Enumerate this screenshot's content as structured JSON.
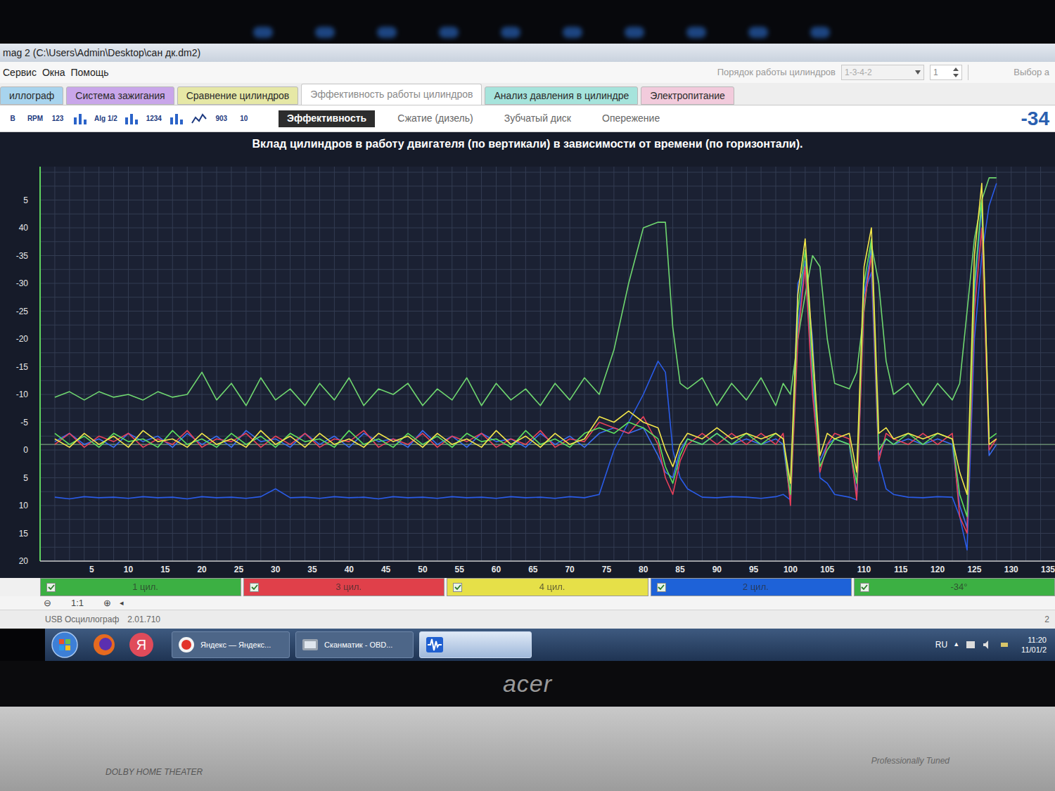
{
  "window": {
    "title": "mag 2 (C:\\Users\\Admin\\Desktop\\сан дк.dm2)"
  },
  "menu": [
    "Сервис",
    "Окна",
    "Помощь"
  ],
  "cylinder_order": {
    "label": "Порядок работы цилиндров",
    "value": "1-3-4-2",
    "spinner": "1",
    "extra": "Выбор а"
  },
  "tabs": [
    {
      "label": "иллограф",
      "selected": false,
      "color": "#a8d4ee"
    },
    {
      "label": "Система зажигания",
      "selected": false,
      "color": "#c9a6ea"
    },
    {
      "label": "Сравнение цилиндров",
      "selected": false,
      "color": "#e6e8a6"
    },
    {
      "label": "Эффективность работы цилиндров",
      "selected": true,
      "color": "#ffffff"
    },
    {
      "label": "Анализ давления в цилиндре",
      "selected": false,
      "color": "#a6e4dc"
    },
    {
      "label": "Электропитание",
      "selected": false,
      "color": "#f2cbdc"
    }
  ],
  "toolbar": {
    "icons": [
      {
        "text": "B"
      },
      {
        "text": "RPM"
      },
      {
        "text": "123"
      },
      {
        "text": ""
      },
      {
        "text": "Alg 1/2"
      },
      {
        "text": ""
      },
      {
        "text": "1234"
      },
      {
        "text": ""
      },
      {
        "text": ""
      },
      {
        "text": "903"
      },
      {
        "text": "10"
      }
    ],
    "modes": [
      {
        "label": "Эффективность",
        "selected": true
      },
      {
        "label": "Сжатие (дизель)",
        "selected": false
      },
      {
        "label": "Зубчатый диск",
        "selected": false
      },
      {
        "label": "Опережение",
        "selected": false
      }
    ],
    "reading": "-34"
  },
  "chart": {
    "title": "Вклад цилиндров в работу двигателя (по вертикали) в зависимости от времени (по горизонтали).",
    "x_ticks": [
      "5",
      "10",
      "15",
      "20",
      "25",
      "30",
      "35",
      "40",
      "45",
      "50",
      "55",
      "60",
      "65",
      "70",
      "75",
      "80",
      "85",
      "90",
      "95",
      "100",
      "105",
      "110",
      "115",
      "120",
      "125",
      "130",
      "135"
    ],
    "y_ticks": [
      {
        "label": "5",
        "value": -45
      },
      {
        "label": "40",
        "value": -40
      },
      {
        "label": "-35",
        "value": -35
      },
      {
        "label": "-30",
        "value": -30
      },
      {
        "label": "-25",
        "value": -25
      },
      {
        "label": "-20",
        "value": -20
      },
      {
        "label": "-15",
        "value": -15
      },
      {
        "label": "-10",
        "value": -10
      },
      {
        "label": "-5",
        "value": -5
      },
      {
        "label": "0",
        "value": 0
      },
      {
        "label": "5",
        "value": 5
      },
      {
        "label": "10",
        "value": 10
      },
      {
        "label": "15",
        "value": 15
      },
      {
        "label": "20",
        "value": 20
      }
    ],
    "x": [
      0,
      2,
      4,
      6,
      8,
      10,
      12,
      14,
      16,
      18,
      20,
      22,
      24,
      26,
      28,
      30,
      32,
      34,
      36,
      38,
      40,
      42,
      44,
      46,
      48,
      50,
      52,
      54,
      56,
      58,
      60,
      62,
      64,
      66,
      68,
      70,
      72,
      74,
      76,
      78,
      80,
      82,
      83,
      84,
      85,
      86,
      88,
      90,
      92,
      94,
      96,
      98,
      99,
      100,
      101,
      102,
      103,
      104,
      105,
      106,
      108,
      109,
      110,
      111,
      112,
      113,
      114,
      116,
      118,
      120,
      122,
      123,
      124,
      125,
      126,
      127,
      128
    ],
    "series": [
      {
        "color": "#6fd66f",
        "values": [
          -9.5,
          -10.5,
          -9,
          -10.5,
          -9.5,
          -10,
          -9,
          -10.5,
          -9.5,
          -10,
          -14,
          -9,
          -12,
          -8,
          -13,
          -9,
          -11,
          -8,
          -12,
          -9,
          -13,
          -8,
          -11,
          -10,
          -12,
          -8,
          -11,
          -9,
          -13,
          -8,
          -12,
          -9,
          -11,
          -8,
          -12,
          -9,
          -13,
          -10,
          -18,
          -30,
          -40,
          -41,
          -41,
          -22,
          -12,
          -11,
          -13,
          -8,
          -12,
          -9,
          -13,
          -8,
          -12,
          -10,
          -20,
          -28,
          -35,
          -33,
          -20,
          -12,
          -11,
          -14,
          -25,
          -37,
          -30,
          -16,
          -10,
          -12,
          -8,
          -12,
          -9,
          -12,
          -25,
          -38,
          -45,
          -49,
          -49
        ]
      },
      {
        "color": "#2a5ce8",
        "values": [
          8.5,
          8.8,
          8.4,
          8.6,
          8.5,
          8.7,
          8.4,
          8.6,
          8.5,
          8.8,
          8.4,
          8.6,
          8.5,
          8.7,
          8.4,
          7,
          8.6,
          8.5,
          8.7,
          8.4,
          8.6,
          8.5,
          8.8,
          8.4,
          8.6,
          8.5,
          8.7,
          8.4,
          8.6,
          8.5,
          8.7,
          8.4,
          8.6,
          8.5,
          8.7,
          8.4,
          8.6,
          8,
          0,
          -5,
          -10,
          -16,
          -14,
          0,
          5,
          7,
          8.5,
          8.6,
          8.4,
          8.5,
          8.7,
          8.4,
          8,
          9,
          -30,
          -33,
          -20,
          5,
          6,
          8,
          8.5,
          9,
          -28,
          -32,
          2,
          7,
          8,
          8.5,
          8.6,
          8.4,
          8.5,
          12,
          18,
          -20,
          -35,
          -44,
          -48
        ]
      },
      {
        "color": "#3a6cf0",
        "values": [
          -1.5,
          -3,
          -1,
          -2,
          -0.5,
          -3,
          -1.5,
          -2.5,
          -0.5,
          -3,
          -1,
          -2.5,
          -0.5,
          -3.5,
          -1.5,
          -2,
          -0.5,
          -3,
          -1,
          -2.5,
          -0.5,
          -3,
          -1.5,
          -2,
          -0.5,
          -3.5,
          -1,
          -2.5,
          -0.5,
          -3,
          -1.5,
          -2,
          -0.5,
          -3,
          -1,
          -2.5,
          -0.5,
          -3,
          -4,
          -3,
          -4,
          1,
          4,
          5,
          0,
          -2,
          -1,
          -3,
          -1,
          -2,
          -1,
          -2,
          -1,
          9,
          -22,
          -34,
          -12,
          2,
          -1,
          -2,
          -1,
          8,
          -28,
          -36,
          1,
          -2,
          -1,
          -2,
          -1,
          -2,
          -1,
          10,
          14,
          -28,
          -44,
          1,
          -1
        ]
      },
      {
        "color": "#e8405a",
        "values": [
          -1,
          -3,
          -0.5,
          -2.5,
          -1.5,
          -3,
          -0.5,
          -2,
          -1,
          -3.5,
          -0.5,
          -2,
          -1.5,
          -3,
          -0.5,
          -2.5,
          -1,
          -3,
          -0.5,
          -2,
          -1.5,
          -3.5,
          -0.5,
          -2,
          -1,
          -3,
          -0.5,
          -2.5,
          -1.5,
          -3,
          -0.5,
          -2,
          -1,
          -3.5,
          -0.5,
          -2,
          -1.5,
          -5,
          -4,
          -3,
          -6,
          -1,
          5,
          8,
          2,
          -1,
          -3,
          -1,
          -3,
          -1,
          -3,
          -1,
          -3,
          10,
          -20,
          -33,
          -10,
          4,
          -1,
          -3,
          -2,
          9,
          -26,
          -35,
          2,
          -3,
          -2,
          -1,
          -3,
          -1,
          -3,
          12,
          15,
          -25,
          -40,
          0,
          -2
        ]
      },
      {
        "color": "#5ee05e",
        "values": [
          -3,
          -1,
          -2.5,
          -0.5,
          -3,
          -1.5,
          -2,
          -0.5,
          -3.5,
          -1,
          -2,
          -0.5,
          -3,
          -1,
          -2.5,
          -0.5,
          -3,
          -1.5,
          -2,
          -0.5,
          -3.5,
          -1,
          -2,
          -0.5,
          -3,
          -1,
          -2.5,
          -0.5,
          -3,
          -1.5,
          -2,
          -0.5,
          -3.5,
          -1,
          -2,
          -0.5,
          -3,
          -4,
          -3,
          -5,
          -4,
          -2,
          3,
          6,
          1,
          -2,
          -1,
          -3,
          -1,
          -3,
          -1,
          -3,
          -2,
          8,
          -25,
          -36,
          -15,
          3,
          0,
          -2,
          -1,
          6,
          -30,
          -38,
          0,
          -2,
          -1,
          -3,
          -1,
          -3,
          -2,
          8,
          12,
          -30,
          -45,
          -2,
          -3
        ]
      },
      {
        "color": "#f2e64a",
        "values": [
          -2,
          -0.5,
          -3,
          -1,
          -2.5,
          -0.5,
          -3.5,
          -1.5,
          -2,
          -0.5,
          -3,
          -1,
          -2,
          -0.5,
          -3.5,
          -1,
          -2.5,
          -0.5,
          -3,
          -1,
          -2,
          -0.5,
          -3,
          -1.5,
          -2.5,
          -0.5,
          -3,
          -1,
          -2,
          -0.5,
          -3.5,
          -1,
          -2.5,
          -0.5,
          -3,
          -1,
          -2,
          -6,
          -5,
          -7,
          -5,
          -4,
          0,
          3,
          -1,
          -3,
          -2,
          -4,
          -2,
          -3,
          -2,
          -3,
          -2,
          6,
          -28,
          -38,
          -18,
          1,
          -3,
          -2,
          -3,
          4,
          -33,
          -40,
          -3,
          -4,
          -2,
          -3,
          -2,
          -3,
          -2,
          4,
          8,
          -35,
          -48,
          -1,
          -2
        ]
      }
    ]
  },
  "legend": [
    {
      "label": "1 цил.",
      "color": "#3cb043",
      "checked": true
    },
    {
      "label": "3 цил.",
      "color": "#e0404a",
      "checked": true
    },
    {
      "label": "4 цил.",
      "color": "#e6e048",
      "checked": true
    },
    {
      "label": "2 цил.",
      "color": "#1e62d8",
      "checked": true
    },
    {
      "label": "-34°",
      "color": "#3cb043",
      "checked": true
    }
  ],
  "zoom": {
    "out": "⊖",
    "ratio": "1:1",
    "in": "⊕",
    "arrow": "◂"
  },
  "status": {
    "left": "USB Осциллограф",
    "version": "2.01.710",
    "right": "2"
  },
  "taskbar": {
    "yandex_pin": "Я",
    "tasks": [
      {
        "label": "Яндекс — Яндекс...",
        "kind": "yandex",
        "selected": false
      },
      {
        "label": "Сканматик - OBD...",
        "kind": "scanmatik",
        "selected": false
      },
      {
        "kind": "scope",
        "selected": true
      }
    ],
    "language": "RU",
    "tray_arrow": "▲",
    "time": "11:20",
    "date": "11/01/2"
  },
  "bezel": {
    "brand": "acer",
    "audio": "DOLBY HOME THEATER",
    "tagline": "Professionally Tuned"
  }
}
